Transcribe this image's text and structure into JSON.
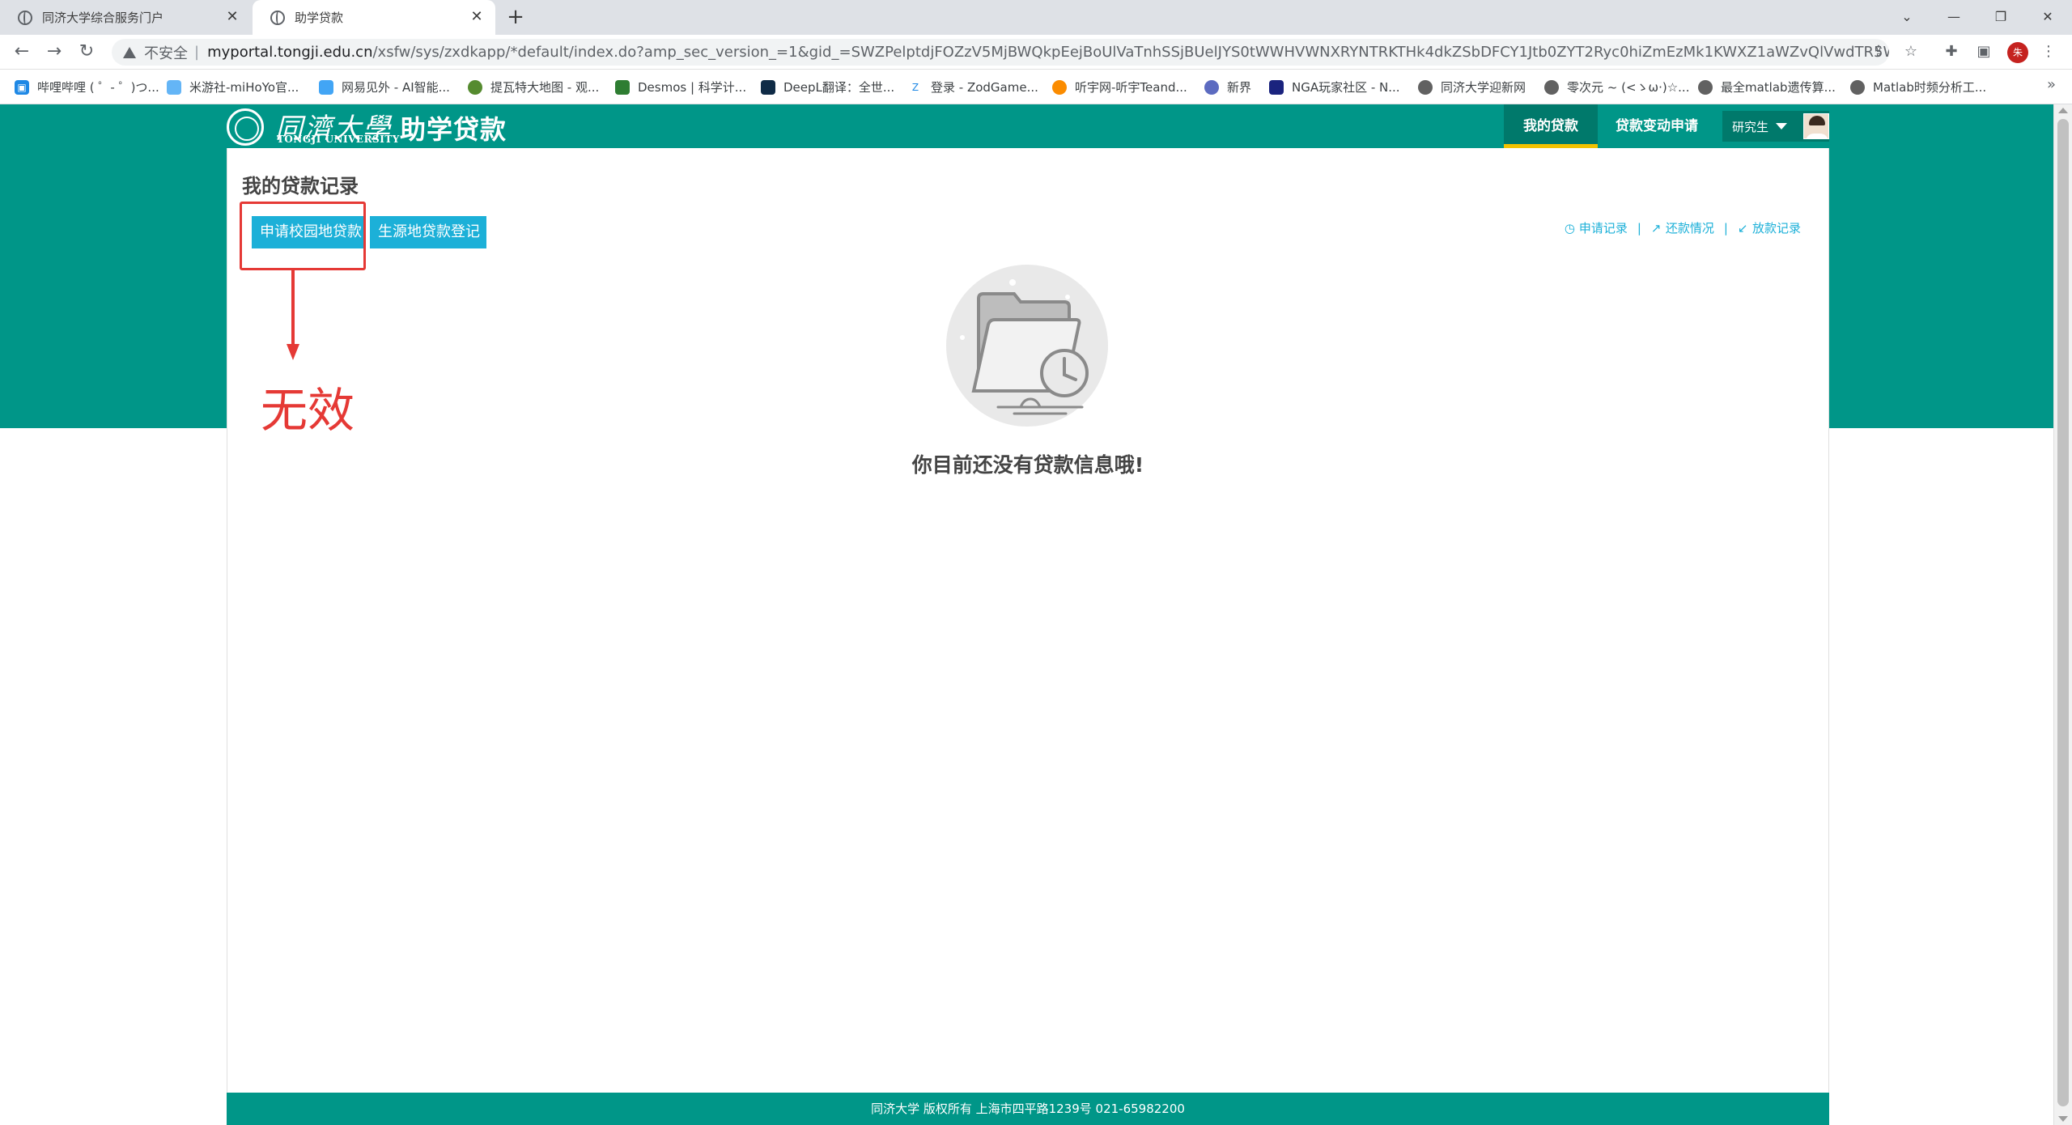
{
  "browser": {
    "tabs": [
      {
        "title": "同济大学综合服务门户",
        "active": false
      },
      {
        "title": "助学贷款",
        "active": true
      }
    ],
    "new_tab": "+",
    "address": {
      "insecure_label": "不安全",
      "host": "myportal.tongji.edu.cn",
      "path": "/xsfw/sys/zxdkapp/*default/index.do?amp_sec_version_=1&gid_=SWZPelptdjFOZzV5MjBWQkpEejBoUlVaTnhSSjBUelJYS0tWWHVWNXRYNTRKTHk4dkZSbDFCY1Jtb0ZYT2Ryc0hiZmEzMk1KWXZ1aWZvQlVwdTR5WHc9PQ..."
    },
    "profile_initial": "朱",
    "bookmarks": [
      {
        "label": "哔哩哔哩 ( ゜- ゜)つ...",
        "color": "#1e88e5"
      },
      {
        "label": "米游社-miHoYo官...",
        "color": "#64b5f6"
      },
      {
        "label": "网易见外 - AI智能...",
        "color": "#42a5f5"
      },
      {
        "label": "提瓦特大地图 - 观...",
        "color": "#558b2f"
      },
      {
        "label": "Desmos | 科学计...",
        "color": "#2e7d32"
      },
      {
        "label": "DeepL翻译：全世...",
        "color": "#0f2b46"
      },
      {
        "label": "登录 - ZodGame...",
        "color": "#1e88e5"
      },
      {
        "label": "听宇网-听宇Teand...",
        "color": "#fb8c00"
      },
      {
        "label": "新界",
        "color": "#5c6bc0"
      },
      {
        "label": "NGA玩家社区 - N...",
        "color": "#1a237e"
      },
      {
        "label": "同济大学迎新网",
        "color": "#616161"
      },
      {
        "label": "零次元 ~ (<ゝω·)☆...",
        "color": "#616161"
      },
      {
        "label": "最全matlab遗传算...",
        "color": "#616161"
      },
      {
        "label": "Matlab时频分析工...",
        "color": "#616161"
      }
    ]
  },
  "app": {
    "logo_cn": "同濟大學",
    "logo_en": "TONGJI UNIVERSITY",
    "title": "助学贷款",
    "nav": [
      {
        "label": "我的贷款",
        "active": true
      },
      {
        "label": "贷款变动申请",
        "active": false
      }
    ],
    "user_role": "研究生"
  },
  "main": {
    "title": "我的贷款记录",
    "buttons": {
      "apply_campus": "申请校园地贷款",
      "register_origin": "生源地贷款登记"
    },
    "links": {
      "apply_records": "申请记录",
      "repay_status": "还款情况",
      "release_records": "放款记录"
    },
    "empty_message": "你目前还没有贷款信息哦!"
  },
  "annotation": {
    "text": "无效",
    "color": "#e53935"
  },
  "footer": {
    "text": "同济大学 版权所有 上海市四平路1239号 021-65982200"
  },
  "colors": {
    "header_green": "#009688",
    "active_nav": "#00796b",
    "active_underline": "#f2c200",
    "button_blue": "#1cb0d8"
  }
}
